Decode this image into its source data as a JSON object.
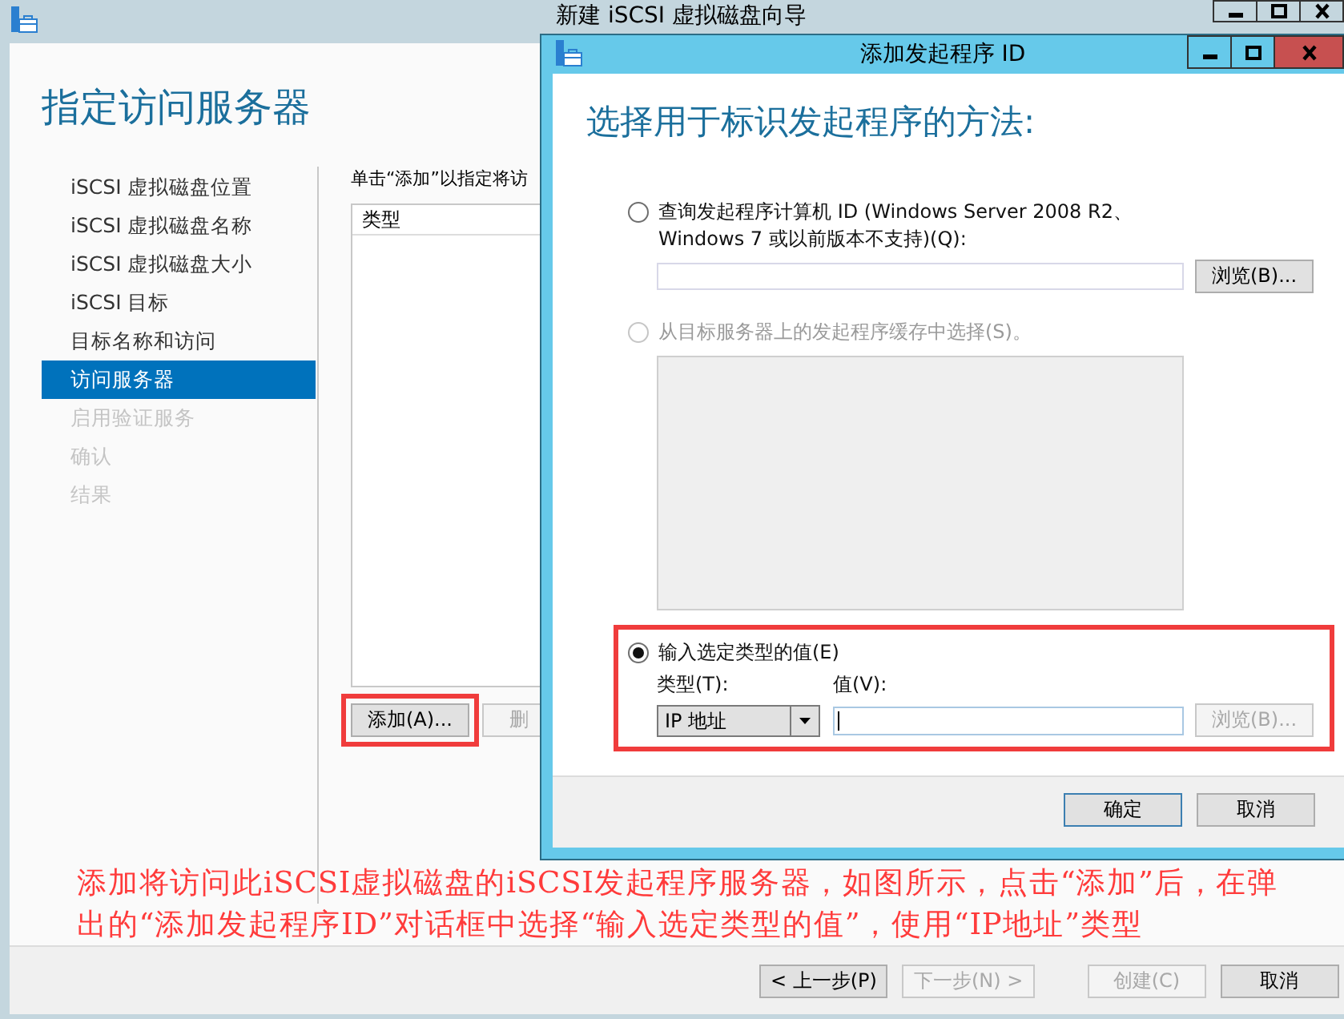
{
  "wizard": {
    "title": "新建 iSCSI 虚拟磁盘向导",
    "heading": "指定访问服务器",
    "steps": [
      {
        "label": "iSCSI 虚拟磁盘位置",
        "selected": false,
        "disabled": false
      },
      {
        "label": "iSCSI 虚拟磁盘名称",
        "selected": false,
        "disabled": false
      },
      {
        "label": "iSCSI 虚拟磁盘大小",
        "selected": false,
        "disabled": false
      },
      {
        "label": "iSCSI 目标",
        "selected": false,
        "disabled": false
      },
      {
        "label": "目标名称和访问",
        "selected": false,
        "disabled": false
      },
      {
        "label": "访问服务器",
        "selected": true,
        "disabled": false
      },
      {
        "label": "启用验证服务",
        "selected": false,
        "disabled": true
      },
      {
        "label": "确认",
        "selected": false,
        "disabled": true
      },
      {
        "label": "结果",
        "selected": false,
        "disabled": true
      }
    ],
    "instruction": "单击“添加”以指定将访",
    "table": {
      "columns": [
        "类型"
      ]
    },
    "buttons": [
      {
        "label": "添加(A)...",
        "disabled": false,
        "highlighted": true
      },
      {
        "label": "删",
        "disabled": true,
        "highlighted": false
      }
    ],
    "annotation": [
      "添加将访问此iSCSI虚拟磁盘的iSCSI发起程序服务器，如图所示，点击“添加”后，在弹",
      "出的“添加发起程序ID”对话框中选择“输入选定类型的值”，使用“IP地址”类型"
    ],
    "footer_buttons": [
      {
        "label": "< 上一步(P)",
        "disabled": false
      },
      {
        "label": "下一步(N) >",
        "disabled": true
      },
      {
        "label": "创建(C)",
        "disabled": true
      },
      {
        "label": "取消",
        "disabled": false
      }
    ]
  },
  "dialog": {
    "title": "添加发起程序 ID",
    "heading": "选择用于标识发起程序的方法:",
    "options": [
      {
        "kind": "query",
        "label": "查询发起程序计算机 ID (Windows Server 2008 R2、",
        "label_line_2": "Windows 7 或以前版本不支持)(Q):",
        "selected": false,
        "disabled": false,
        "highlighted": false,
        "browse_button": {
          "label": "浏览(B)...",
          "disabled": false
        }
      },
      {
        "kind": "cache",
        "label": "从目标服务器上的发起程序缓存中选择(S)。",
        "selected": false,
        "disabled": true,
        "highlighted": false
      },
      {
        "kind": "manual",
        "label": "输入选定类型的值(E)",
        "selected": true,
        "disabled": false,
        "highlighted": true,
        "type_label": "类型(T):",
        "type_value": "IP 地址",
        "value_label": "值(V):",
        "browse_button": {
          "label": "浏览(B)...",
          "disabled": true
        }
      }
    ],
    "buttons": [
      {
        "label": "确定",
        "default": true
      },
      {
        "label": "取消",
        "default": false
      }
    ]
  }
}
